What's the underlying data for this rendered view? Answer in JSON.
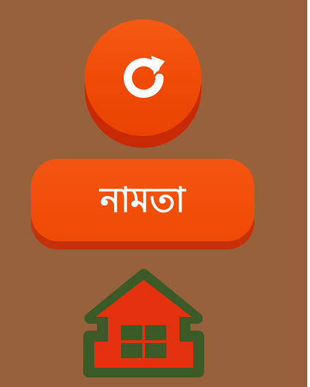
{
  "screen": {
    "name": "menu-screen",
    "background_color": "#97613c"
  },
  "reload_button": {
    "icon": "reload-icon",
    "color": "#ef4a06"
  },
  "namta_button": {
    "label": "নামতা",
    "color": "#ef4a06"
  },
  "home_button": {
    "icon": "home-icon",
    "fill_color": "#e43210",
    "outline_color": "#3c5a28"
  }
}
